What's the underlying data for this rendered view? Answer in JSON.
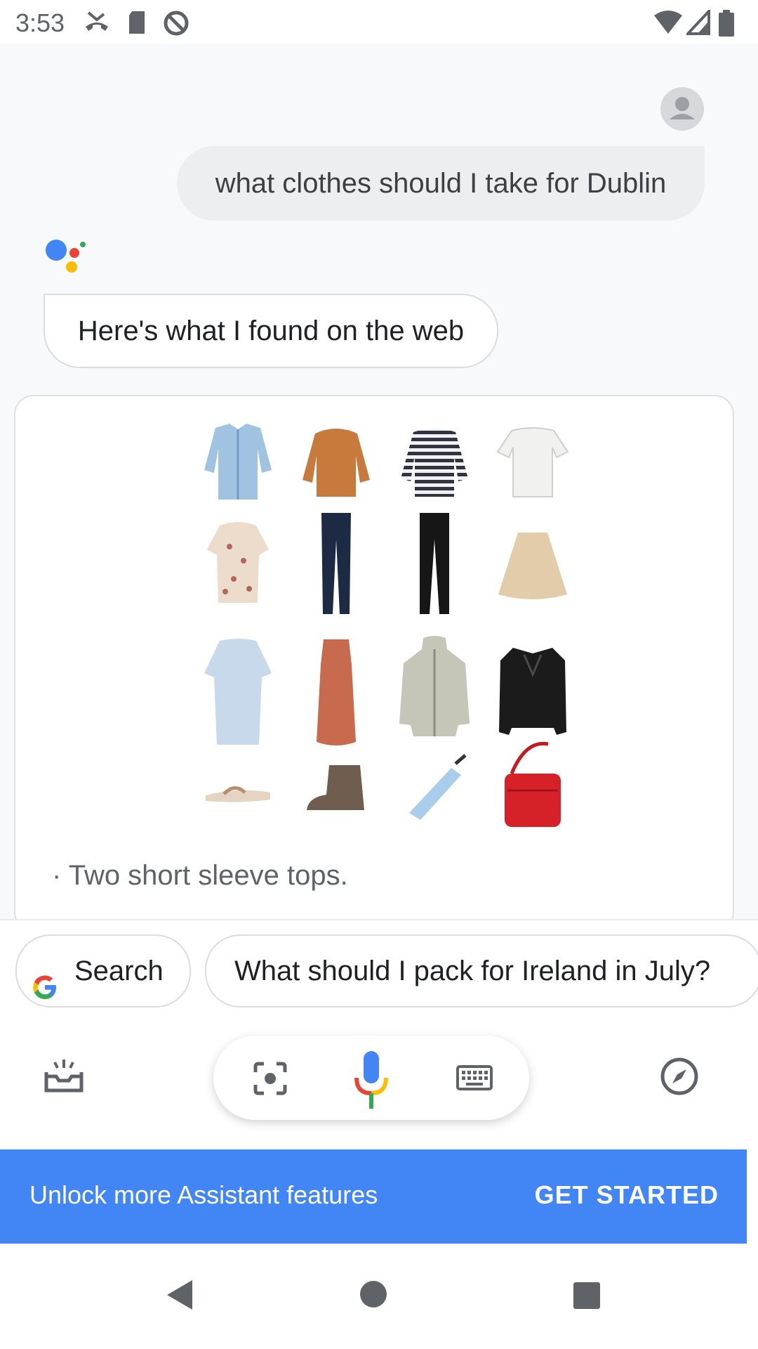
{
  "status_bar": {
    "time": "3:53",
    "icons": [
      "missed-call-icon",
      "sd-card-icon",
      "do-not-disturb-icon",
      "wifi-icon",
      "signal-icon",
      "battery-icon"
    ]
  },
  "conversation": {
    "user_query": "what clothes should I take for Dublin",
    "assistant_reply": "Here's what I found on the web",
    "result_card": {
      "image_items": [
        "denim-shirt",
        "orange-sweater",
        "striped-top",
        "white-tee",
        "floral-blouse",
        "skinny-jeans",
        "black-pants",
        "tan-skirt",
        "light-blue-tunic",
        "rust-dress",
        "rain-jacket",
        "leather-jacket",
        "sandals",
        "ankle-boots",
        "umbrella",
        "red-crossbody-bag"
      ],
      "snippet": "· Two short sleeve tops."
    }
  },
  "suggestions": {
    "search_label": "Search",
    "followup_label": "What should I pack for Ireland in July?"
  },
  "input_bar": {
    "icons": [
      "updates-tray-icon",
      "lens-icon",
      "microphone-icon",
      "keyboard-icon",
      "explore-compass-icon"
    ]
  },
  "banner": {
    "text": "Unlock more Assistant features",
    "button": "GET STARTED"
  },
  "colors": {
    "blue": "#4285f4",
    "red": "#ea4335",
    "yellow": "#fbbc04",
    "green": "#34a853",
    "banner_bg": "#4285f4"
  }
}
